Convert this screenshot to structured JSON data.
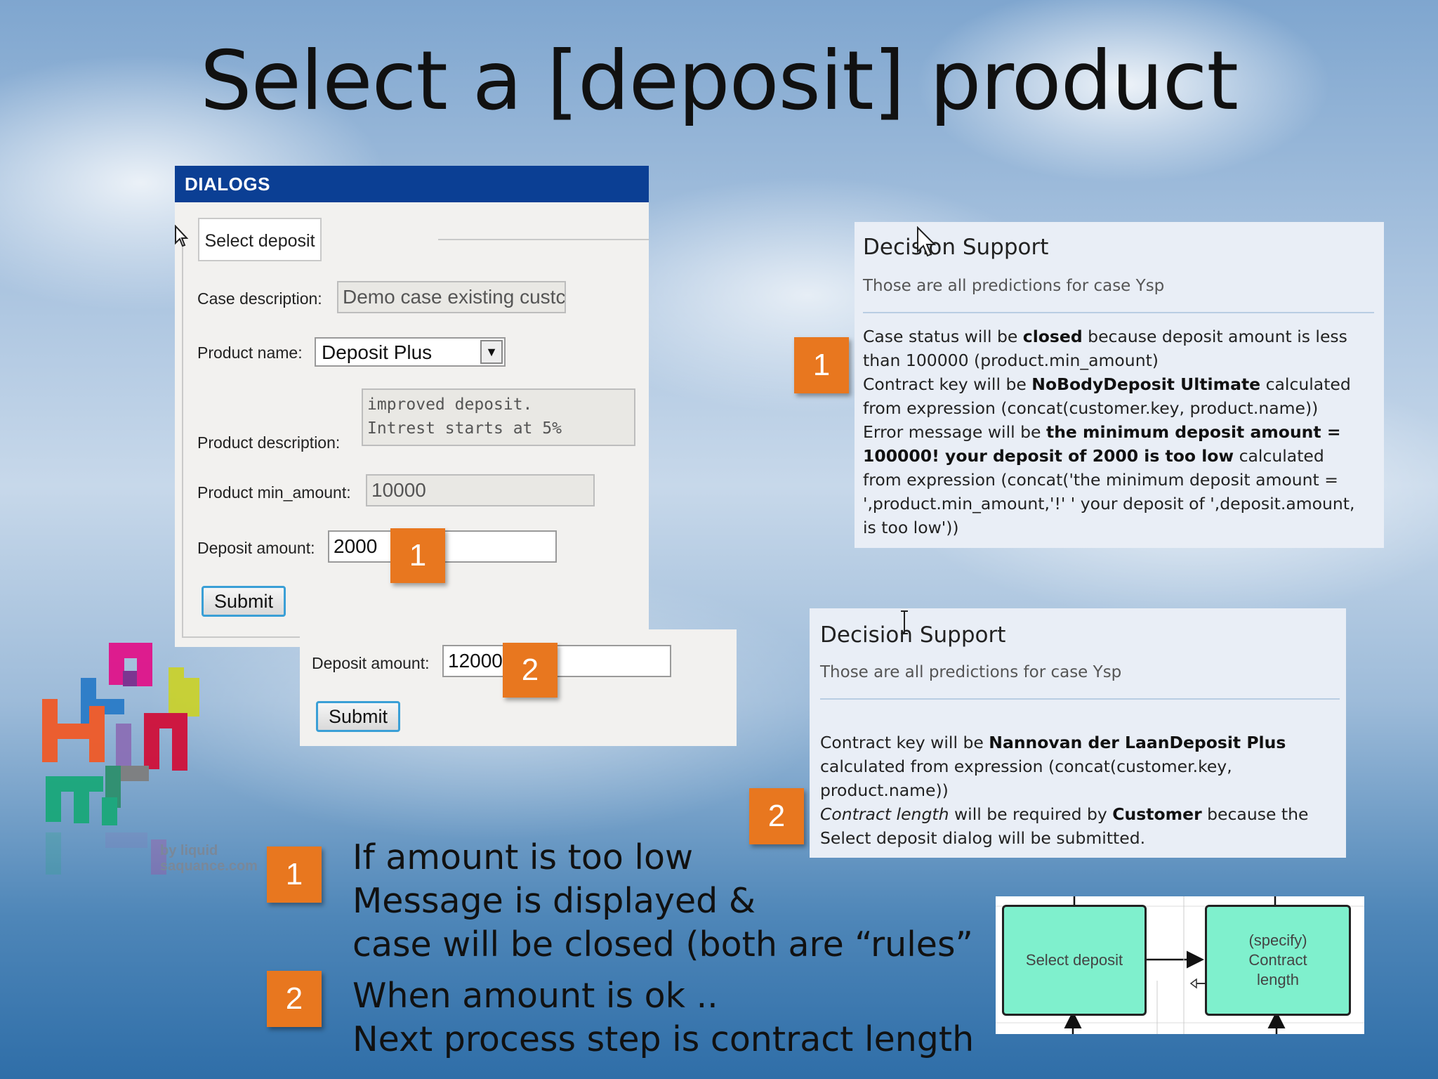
{
  "slide": {
    "title": "Select a [deposit] product"
  },
  "dialog": {
    "header": "DIALOGS",
    "tab_label": "Select deposit",
    "fields": {
      "case_description_label": "Case description:",
      "case_description_value": "Demo case existing custc",
      "product_name_label": "Product name:",
      "product_name_value": "Deposit Plus",
      "product_description_label": "Product description:",
      "product_description_line1": "improved deposit.",
      "product_description_line2": "Intrest starts at 5%",
      "product_min_amount_label": "Product min_amount:",
      "product_min_amount_value": "10000",
      "deposit_amount_label": "Deposit amount:",
      "deposit_amount_value": "2000"
    },
    "submit_label": "Submit"
  },
  "dialog2": {
    "deposit_amount_label": "Deposit amount:",
    "deposit_amount_value": "12000",
    "submit_label": "Submit"
  },
  "badges": {
    "one": "1",
    "two": "2"
  },
  "decision1": {
    "title": "Decision Support",
    "subtitle": "Those are all predictions for case Ysp",
    "l1a": "Case status will be ",
    "l1b": "closed",
    "l1c": " because deposit amount is less",
    "l2": "than 100000 (product.min_amount)",
    "l3a": "Contract key will be ",
    "l3b": "NoBodyDeposit Ultimate",
    "l3c": " calculated",
    "l4": "from expression (concat(customer.key, product.name))",
    "l5a": "Error message will be ",
    "l5b": "the minimum deposit amount =",
    "l6a": "100000! your deposit of 2000 is too low",
    "l6b": " calculated",
    "l7": "from expression (concat('the minimum deposit amount =",
    "l8": "',product.min_amount,'!' ' your deposit of ',deposit.amount,",
    "l9": "is too low'))"
  },
  "decision2": {
    "title": "Decision Support",
    "subtitle": "Those are all predictions for case Ysp",
    "l1a": "Contract key will be ",
    "l1b": "Nannovan der LaanDeposit Plus",
    "l2": "calculated from expression (concat(customer.key,",
    "l3": "product.name))",
    "l4a": "Contract length",
    "l4b": " will be required by ",
    "l4c": "Customer",
    "l4d": " because the",
    "l5": "Select deposit dialog will be submitted."
  },
  "bullets": {
    "one_line1": "If amount is too low",
    "one_line2": "Message is displayed &",
    "one_line3": "case will be closed (both are “rules”",
    "two_line1": "When amount is ok ..",
    "two_line2": "Next process step is contract length"
  },
  "logo": {
    "caption_line1": "by liquid",
    "caption_line2": "saquance.com"
  },
  "process": {
    "box1": "Select deposit",
    "box2_line1": "(specify)",
    "box2_line2": "Contract",
    "box2_line3": "length"
  },
  "colors": {
    "badge": "#e8771f",
    "dialog_header": "#0b3f94",
    "process_box": "#7ff0cd",
    "button_border": "#3a9fd6"
  }
}
